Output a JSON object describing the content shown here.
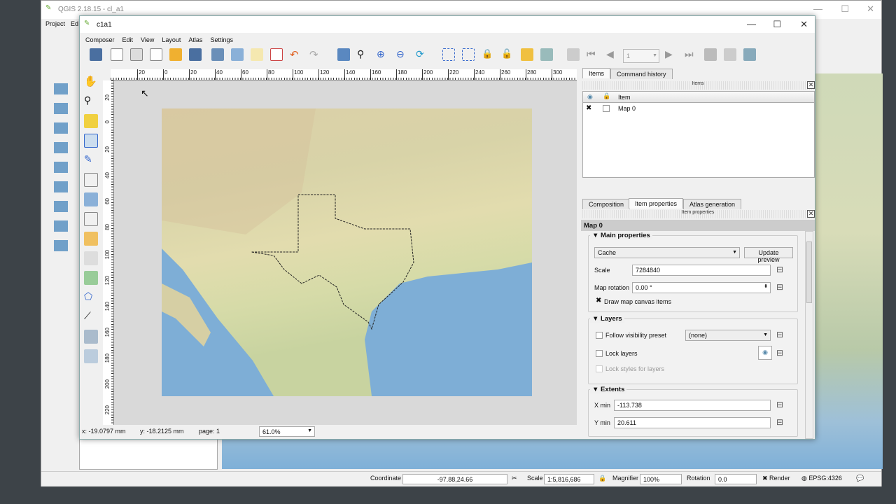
{
  "qgis": {
    "title": "QGIS 2.18.15 - cl_a1",
    "menu": [
      "Project",
      "Ed"
    ],
    "status": {
      "coordinate_label": "Coordinate",
      "coordinate": "-97.88,24.66",
      "scale_label": "Scale",
      "scale": "1:5,816,686",
      "magnifier_label": "Magnifier",
      "magnifier": "100%",
      "rotation_label": "Rotation",
      "rotation": "0.0",
      "render_label": "Render",
      "crs": "EPSG:4326"
    }
  },
  "composer": {
    "title": "c1a1",
    "menu": [
      "Composer",
      "Edit",
      "View",
      "Layout",
      "Atlas",
      "Settings"
    ],
    "page_number": "1",
    "hruler": [
      "20",
      "0",
      "20",
      "40",
      "60",
      "80",
      "100",
      "120",
      "140",
      "160",
      "180",
      "200",
      "220",
      "240",
      "260",
      "280",
      "300"
    ],
    "vruler": [
      "20",
      "0",
      "20",
      "40",
      "60",
      "80",
      "100",
      "120",
      "140",
      "160",
      "180",
      "200",
      "220"
    ],
    "status": {
      "x": "x: -19.0797 mm",
      "y": "y: -18.2125 mm",
      "page": "page: 1",
      "zoom": "61.0%"
    }
  },
  "panel": {
    "top_tabs": [
      "Items",
      "Command history"
    ],
    "items_header": "Items",
    "col_item": "Item",
    "items": [
      {
        "name": "Map 0",
        "visible": true,
        "locked": false
      }
    ],
    "bottom_tabs": [
      "Composition",
      "Item properties",
      "Atlas generation"
    ],
    "props_header": "Item properties",
    "item_title": "Map 0",
    "main": {
      "title": "Main properties",
      "cache": "Cache",
      "update": "Update preview",
      "scale_label": "Scale",
      "scale": "7284840",
      "rot_label": "Map rotation",
      "rot": "0.00 °",
      "draw_items": "Draw map canvas items"
    },
    "layers": {
      "title": "Layers",
      "follow": "Follow visibility preset",
      "preset": "(none)",
      "lock": "Lock layers",
      "lock_styles": "Lock styles for layers"
    },
    "extents": {
      "title": "Extents",
      "xmin_label": "X min",
      "xmin": "-113.738",
      "ymin_label": "Y min",
      "ymin": "20.611"
    }
  }
}
